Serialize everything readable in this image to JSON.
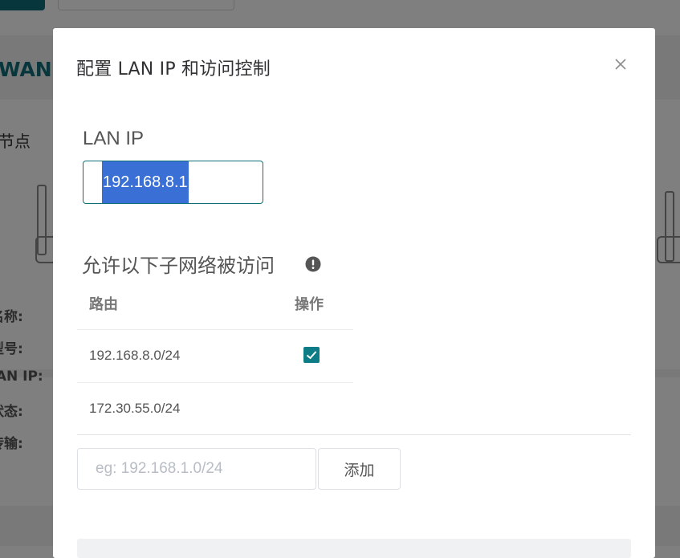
{
  "background": {
    "wan_label": "WAN",
    "node_label": "节点",
    "field_labels": [
      "名称:",
      "型号:",
      "LAN IP:",
      "状态:",
      "传输:"
    ]
  },
  "modal": {
    "title": "配置 LAN IP 和访问控制",
    "close_icon": "close-icon",
    "lan_ip": {
      "label": "LAN IP",
      "value": "192.168.8.1"
    },
    "allowed_subnets": {
      "heading": "允许以下子网络被访问",
      "info_icon": "info-circle-icon",
      "columns": {
        "route": "路由",
        "action": "操作"
      },
      "rows": [
        {
          "route": "192.168.8.0/24",
          "checked": true
        },
        {
          "route": "172.30.55.0/24",
          "checked": false
        }
      ]
    },
    "add": {
      "placeholder": "eg: 192.168.1.0/24",
      "value": "",
      "button_label": "添加"
    }
  },
  "colors": {
    "accent": "#0e6f78",
    "checkbox": "#0e7c86",
    "selection": "#3a6fd6",
    "overlay": "rgba(0,0,0,0.5)"
  }
}
